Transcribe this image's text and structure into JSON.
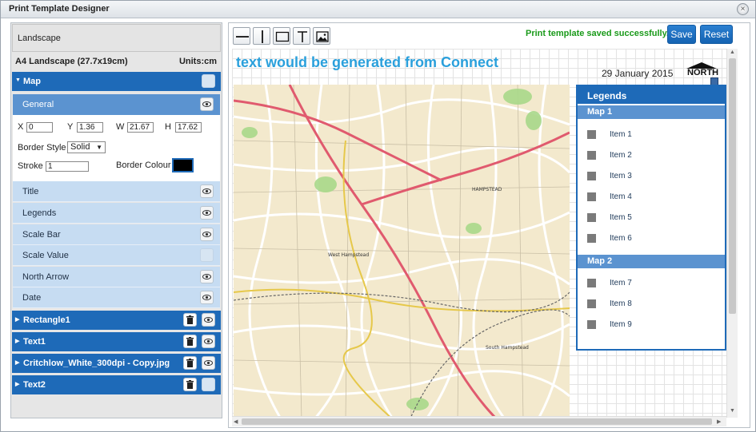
{
  "window": {
    "title": "Print Template Designer"
  },
  "left": {
    "template_name": "Landscape",
    "paper_size": "A4 Landscape (27.7x19cm)",
    "units": "Units:cm",
    "map": {
      "label": "Map",
      "general": {
        "label": "General",
        "x_label": "X",
        "x_value": "0",
        "y_label": "Y",
        "y_value": "1.36",
        "w_label": "W",
        "w_value": "21.67",
        "h_label": "H",
        "h_value": "17.62",
        "border_style_label": "Border Style",
        "border_style_value": "Solid",
        "stroke_label": "Stroke",
        "stroke_value": "1",
        "border_colour_label": "Border Colour",
        "border_colour": "#000000"
      },
      "sub_items": [
        "Title",
        "Legends",
        "Scale Bar",
        "Scale Value",
        "North Arrow",
        "Date"
      ]
    },
    "elements": [
      "Rectangle1",
      "Text1",
      "Critchlow_White_300dpi - Copy.jpg",
      "Text2"
    ]
  },
  "toolbar": {
    "tools": [
      "line-horizontal-icon",
      "line-vertical-icon",
      "rectangle-icon",
      "text-icon",
      "image-icon"
    ],
    "status": "Print template saved successfully.",
    "save_label": "Save",
    "reset_label": "Reset"
  },
  "canvas": {
    "text_element": "text would be generated from Connect",
    "date": "29 January 2015",
    "north_label": "NORTH",
    "map_labels": [
      "HAMPSTEAD",
      "West Hampstead",
      "South Hampstead"
    ],
    "legend": {
      "title": "Legends",
      "groups": [
        {
          "name": "Map 1",
          "items": [
            "Item 1",
            "Item 2",
            "Item 3",
            "Item 4",
            "Item 5",
            "Item 6"
          ]
        },
        {
          "name": "Map 2",
          "items": [
            "Item 7",
            "Item 8",
            "Item 9"
          ]
        }
      ]
    }
  },
  "colors": {
    "accent": "#1e6ab8",
    "accent_light": "#5b93d0",
    "sub_bg": "#c6dcf2",
    "status": "#1a9a1a",
    "title_text": "#2aa0dc"
  }
}
